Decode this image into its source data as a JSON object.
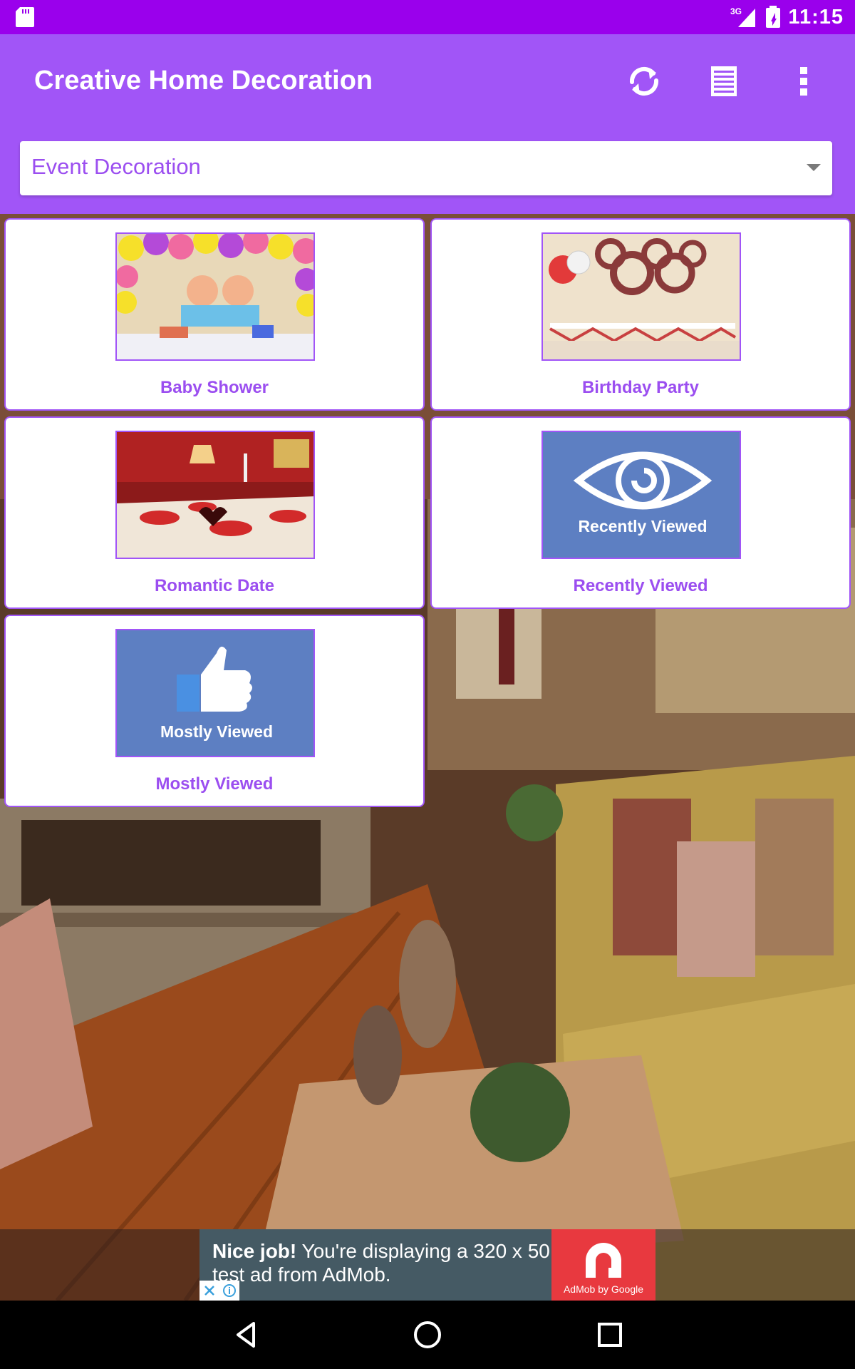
{
  "status_bar": {
    "time": "11:15",
    "network": "3G",
    "icons": [
      "sd-card-icon",
      "signal-icon",
      "battery-icon"
    ]
  },
  "app_bar": {
    "title": "Creative Home Decoration",
    "actions": [
      "refresh-icon",
      "list-icon",
      "more-vert-icon"
    ],
    "color": "#a155f7"
  },
  "category_select": {
    "selected": "Event Decoration"
  },
  "tiles": [
    {
      "label": "Baby Shower"
    },
    {
      "label": "Birthday Party"
    },
    {
      "label": "Romantic Date"
    },
    {
      "label": "Recently Viewed",
      "image_text": "Recently Viewed"
    },
    {
      "label": "Mostly Viewed",
      "image_text": "Mostly Viewed"
    }
  ],
  "ad": {
    "headline": "Nice job!",
    "body": " You're displaying a 320 x 50 test ad from AdMob.",
    "brand": "AdMob by Google"
  },
  "nav_bar": {
    "buttons": [
      "back-icon",
      "home-icon",
      "recents-icon"
    ]
  },
  "colors": {
    "accent": "#a155f7",
    "status_bar": "#9a00ec",
    "label": "#9b4ef0",
    "thumb_blue": "#5d7fc2"
  }
}
